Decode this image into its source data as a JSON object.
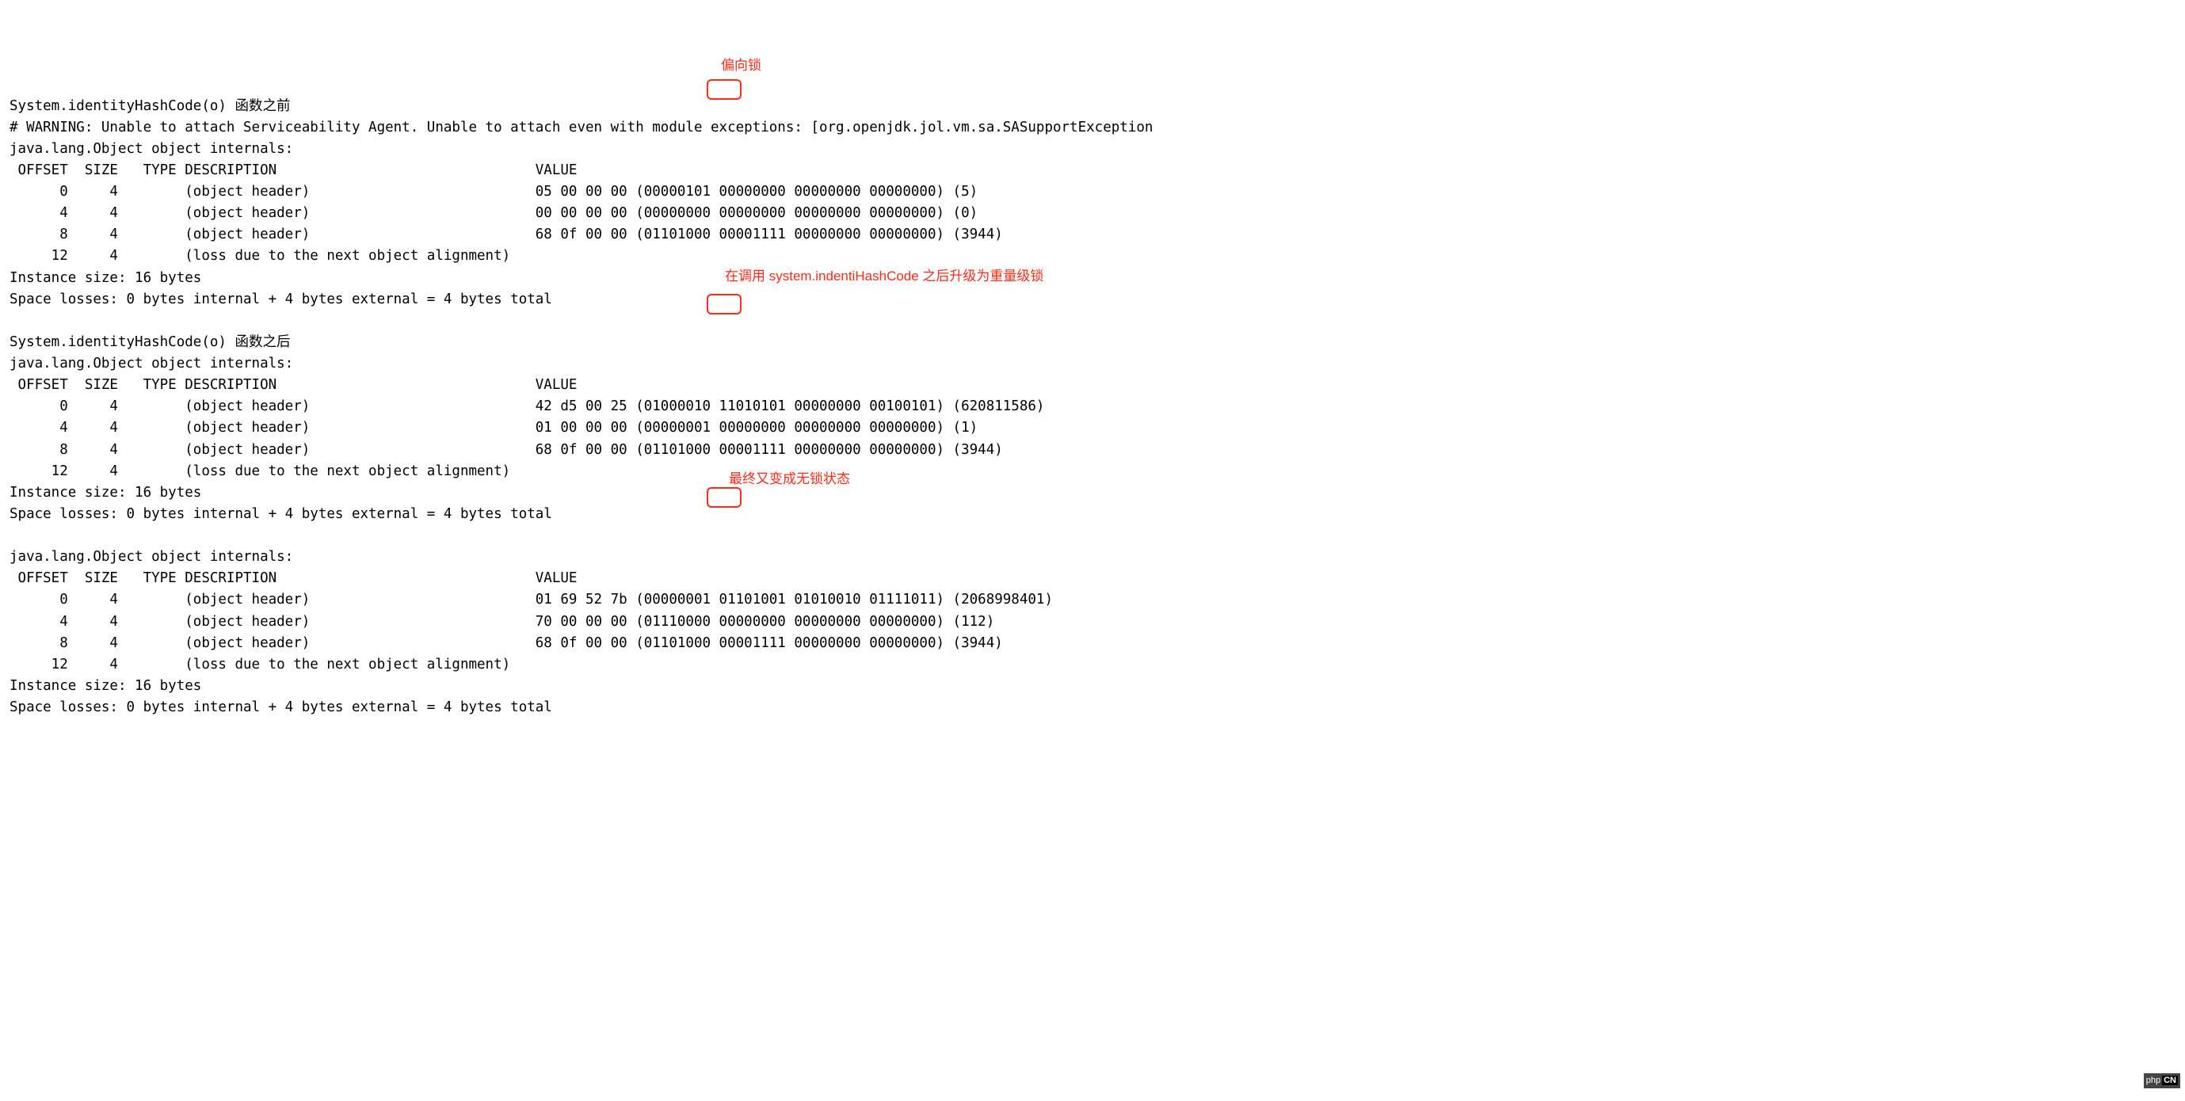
{
  "block1": {
    "title": "System.identityHashCode(o) 函数之前",
    "warning": "# WARNING: Unable to attach Serviceability Agent. Unable to attach even with module exceptions: [org.openjdk.jol.vm.sa.SASupportException",
    "header": "java.lang.Object object internals:",
    "cols": " OFFSET  SIZE   TYPE DESCRIPTION                               VALUE",
    "rows": [
      "      0     4        (object header)                           05 00 00 00 (00000101 00000000 00000000 00000000) (5)",
      "      4     4        (object header)                           00 00 00 00 (00000000 00000000 00000000 00000000) (0)",
      "      8     4        (object header)                           68 0f 00 00 (01101000 00001111 00000000 00000000) (3944)",
      "     12     4        (loss due to the next object alignment)"
    ],
    "size": "Instance size: 16 bytes",
    "loss": "Space losses: 0 bytes internal + 4 bytes external = 4 bytes total",
    "anno": "偏向锁"
  },
  "block2": {
    "title": "System.identityHashCode(o) 函数之后",
    "header": "java.lang.Object object internals:",
    "cols": " OFFSET  SIZE   TYPE DESCRIPTION                               VALUE",
    "rows": [
      "      0     4        (object header)                           42 d5 00 25 (01000010 11010101 00000000 00100101) (620811586)",
      "      4     4        (object header)                           01 00 00 00 (00000001 00000000 00000000 00000000) (1)",
      "      8     4        (object header)                           68 0f 00 00 (01101000 00001111 00000000 00000000) (3944)",
      "     12     4        (loss due to the next object alignment)"
    ],
    "size": "Instance size: 16 bytes",
    "loss": "Space losses: 0 bytes internal + 4 bytes external = 4 bytes total",
    "anno": "在调用 system.indentiHashCode 之后升级为重量级锁"
  },
  "block3": {
    "header": "java.lang.Object object internals:",
    "cols": " OFFSET  SIZE   TYPE DESCRIPTION                               VALUE",
    "rows": [
      "      0     4        (object header)                           01 69 52 7b (00000001 01101001 01010010 01111011) (2068998401)",
      "      4     4        (object header)                           70 00 00 00 (01110000 00000000 00000000 00000000) (112)",
      "      8     4        (object header)                           68 0f 00 00 (01101000 00001111 00000000 00000000) (3944)",
      "     12     4        (loss due to the next object alignment)"
    ],
    "size": "Instance size: 16 bytes",
    "loss": "Space losses: 0 bytes internal + 4 bytes external = 4 bytes total",
    "anno": "最终又变成无锁状态"
  },
  "watermark": "php"
}
